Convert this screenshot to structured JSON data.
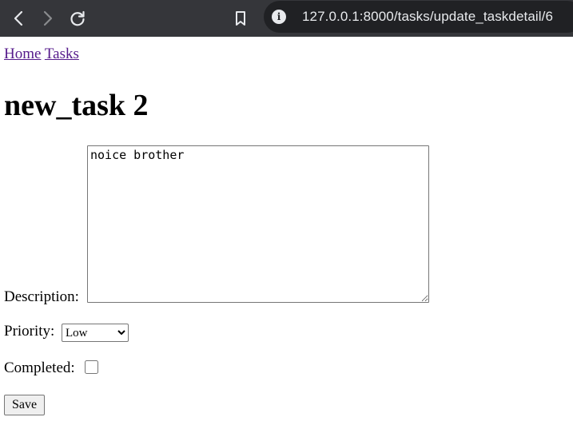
{
  "browser": {
    "url": "127.0.0.1:8000/tasks/update_taskdetail/6",
    "colors": {
      "toolbar": "#35363a",
      "urlbar": "#202124",
      "icon": "#e8eaed"
    }
  },
  "nav": {
    "home": "Home",
    "tasks": "Tasks"
  },
  "page": {
    "title": "new_task 2"
  },
  "form": {
    "description_label": "Description:",
    "description_value": "noice brother",
    "priority_label": "Priority:",
    "priority_selected": "Low",
    "completed_label": "Completed:",
    "completed": false,
    "save_label": "Save"
  }
}
